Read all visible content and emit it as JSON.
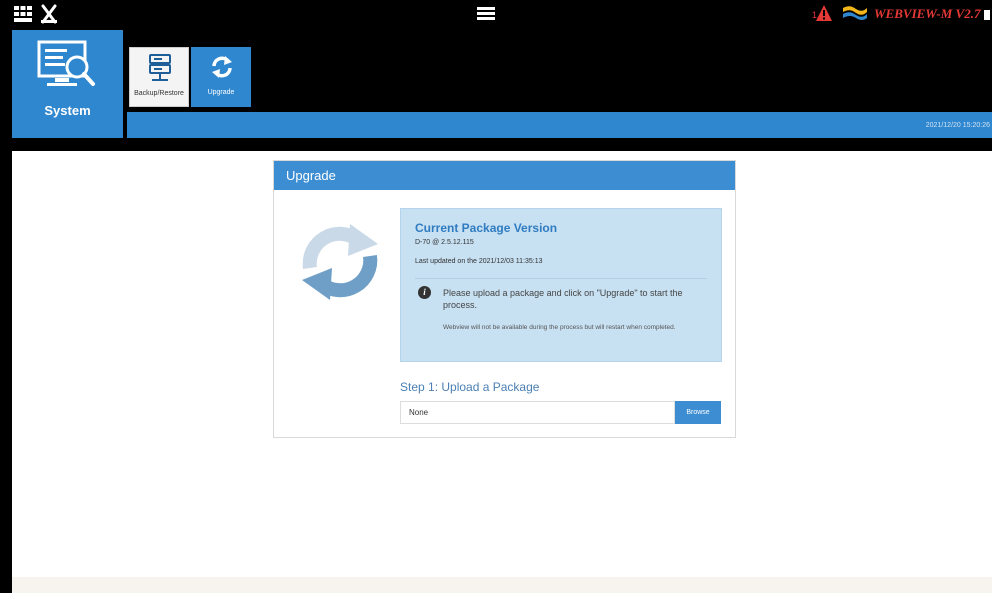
{
  "topbar": {
    "brand_text": "WEBVIEW-M V2.7",
    "alarm_count": "1",
    "icons": [
      "grid-icon",
      "tools-icon",
      "hamburger-menu-icon",
      "alarm-icon",
      "brand-flag-icon"
    ]
  },
  "nav": {
    "system_label": "System",
    "subtiles": [
      {
        "label": "Backup/Restore",
        "icon": "server-icon"
      },
      {
        "label": "Upgrade",
        "icon": "sync-icon"
      }
    ]
  },
  "statusbar": {
    "datetime": "2021/12/20 15:20:26"
  },
  "panel": {
    "title": "Upgrade",
    "current": {
      "title": "Current Package Version",
      "version": "D-70 @ 2.5.12.115",
      "last_updated": "Last updated on the 2021/12/03 11:35:13"
    },
    "message": "Please upload a package and click on \"Upgrade\" to start the process.",
    "note": "Webview will not be available during the process but will restart when completed.",
    "step1_label": "Step 1: Upload a Package",
    "file_value": "None",
    "browse_label": "Browse"
  },
  "colors": {
    "accent": "#2f87cf",
    "panel_header": "#3c8dd2",
    "info_bg": "#c7e0f2",
    "brand": "#e53935"
  }
}
